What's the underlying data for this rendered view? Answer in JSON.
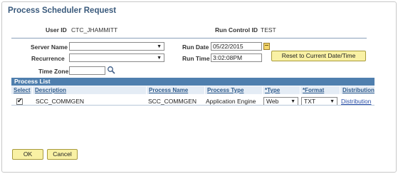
{
  "page": {
    "title": "Process Scheduler Request"
  },
  "header": {
    "user_id_label": "User ID",
    "user_id_value": "CTC_JHAMMITT",
    "run_control_label": "Run Control ID",
    "run_control_value": "TEST"
  },
  "form": {
    "server_name_label": "Server Name",
    "server_name_value": "",
    "recurrence_label": "Recurrence",
    "recurrence_value": "",
    "time_zone_label": "Time Zone",
    "time_zone_value": "",
    "run_date_label": "Run Date",
    "run_date_value": "05/22/2015",
    "run_time_label": "Run Time",
    "run_time_value": "3:02:08PM",
    "reset_button": "Reset to Current Date/Time"
  },
  "process_list": {
    "title": "Process List",
    "columns": [
      "Select",
      "Description",
      "Process Name",
      "Process Type",
      "*Type",
      "*Format",
      "Distribution"
    ],
    "rows": [
      {
        "selected": true,
        "description": "SCC_COMMGEN",
        "process_name": "SCC_COMMGEN",
        "process_type": "Application Engine",
        "type": "Web",
        "format": "TXT",
        "distribution": "Distribution"
      }
    ]
  },
  "footer": {
    "ok_button": "OK",
    "cancel_button": "Cancel"
  },
  "icons": {
    "calendar": "calendar-icon",
    "lookup": "search-icon",
    "dropdown": "chevron-down-icon",
    "checkbox": "check-icon"
  },
  "colors": {
    "title": "#3a5a7c",
    "grid_header": "#4f7fae",
    "column_header_bg": "#e4ecf5",
    "button_bg": "#f9f1a4",
    "link": "#2a4fa8"
  }
}
